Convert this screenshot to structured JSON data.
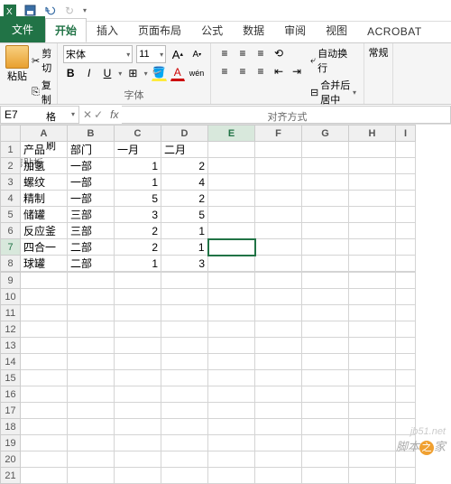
{
  "qat": {
    "save": "",
    "undo": "",
    "redo": ""
  },
  "tabs": {
    "file": "文件",
    "home": "开始",
    "insert": "插入",
    "layout": "页面布局",
    "formulas": "公式",
    "data": "数据",
    "review": "审阅",
    "view": "视图",
    "acrobat": "ACROBAT"
  },
  "ribbon": {
    "clipboard": {
      "paste": "粘贴",
      "cut": "剪切",
      "copy": "复制",
      "format_painter": "格式刷",
      "group": "剪贴板"
    },
    "font": {
      "name": "宋体",
      "size": "11",
      "group": "字体",
      "bold": "B",
      "italic": "I",
      "underline": "U",
      "inc": "A",
      "dec": "A",
      "big_a": "A",
      "small_a": "A"
    },
    "align": {
      "group": "对齐方式",
      "wrap": "自动换行",
      "merge": "合并后居中"
    },
    "number": {
      "general": "常规"
    }
  },
  "namebox": "E7",
  "fx": "fx",
  "columns": [
    "A",
    "B",
    "C",
    "D",
    "E",
    "F",
    "G",
    "H",
    "I"
  ],
  "chart_data": {
    "type": "table",
    "headers": [
      "产品",
      "部门",
      "一月",
      "二月"
    ],
    "rows": [
      {
        "产品": "加氢",
        "部门": "一部",
        "一月": 1,
        "二月": 2
      },
      {
        "产品": "螺纹",
        "部门": "一部",
        "一月": 1,
        "二月": 4
      },
      {
        "产品": "精制",
        "部门": "一部",
        "一月": 5,
        "二月": 2
      },
      {
        "产品": "储罐",
        "部门": "三部",
        "一月": 3,
        "二月": 5
      },
      {
        "产品": "反应釜",
        "部门": "三部",
        "一月": 2,
        "二月": 1
      },
      {
        "产品": "四合一",
        "部门": "二部",
        "一月": 2,
        "二月": 1
      },
      {
        "产品": "球罐",
        "部门": "二部",
        "一月": 1,
        "二月": 3
      }
    ]
  },
  "data": {
    "r1": {
      "A": "产品",
      "B": "部门",
      "C": "一月",
      "D": "二月"
    },
    "r2": {
      "A": "加氢",
      "B": "一部",
      "C": "1",
      "D": "2"
    },
    "r3": {
      "A": "螺纹",
      "B": "一部",
      "C": "1",
      "D": "4"
    },
    "r4": {
      "A": "精制",
      "B": "一部",
      "C": "5",
      "D": "2"
    },
    "r5": {
      "A": "储罐",
      "B": "三部",
      "C": "3",
      "D": "5"
    },
    "r6": {
      "A": "反应釜",
      "B": "三部",
      "C": "2",
      "D": "1"
    },
    "r7": {
      "A": "四合一",
      "B": "二部",
      "C": "2",
      "D": "1"
    },
    "r8": {
      "A": "球罐",
      "B": "二部",
      "C": "1",
      "D": "3"
    }
  },
  "watermark": {
    "text": "脚本",
    "suffix": "家",
    "domain": "jb51.net",
    "zhi": "之"
  }
}
